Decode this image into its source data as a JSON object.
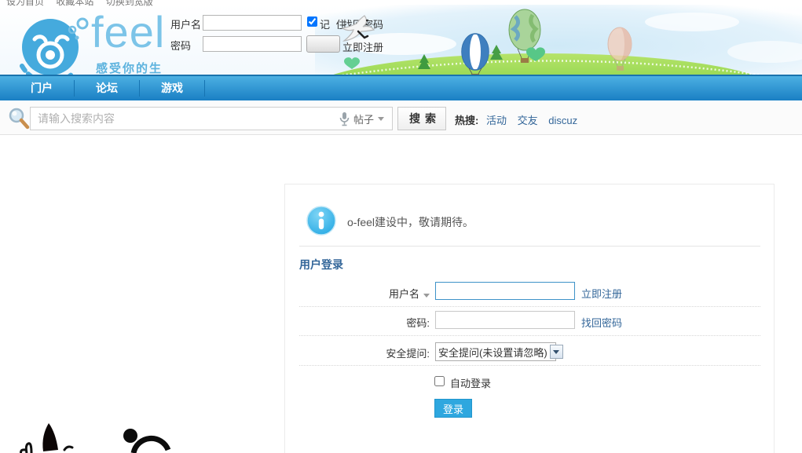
{
  "topbar": {
    "links": [
      {
        "label": "设为首页"
      },
      {
        "label": "收藏本站"
      },
      {
        "label": "切换到宽版"
      }
    ]
  },
  "logo": {
    "brand": "feel",
    "tagline": "感受你的生活"
  },
  "header_login": {
    "username_label": "用户名",
    "password_label": "密码",
    "remember_label": "记 住",
    "remember_checked": true,
    "find_password_link": "找回密码",
    "register_link": "立即注册"
  },
  "nav": {
    "items": [
      {
        "label": "门户"
      },
      {
        "label": "论坛"
      },
      {
        "label": "游戏"
      }
    ]
  },
  "search": {
    "placeholder": "请输入搜索内容",
    "scope": "帖子",
    "button_label": "搜索",
    "hot_label": "热搜:",
    "hot_links": [
      {
        "label": "活动"
      },
      {
        "label": "交友"
      },
      {
        "label": "discuz"
      }
    ]
  },
  "notice": {
    "text": "o-feel建设中，敬请期待。"
  },
  "login_panel": {
    "title": "用户登录",
    "username_label": "用户名",
    "register_link": "立即注册",
    "password_label": "密码:",
    "find_password_link": "找回密码",
    "security_label": "安全提问:",
    "security_selected": "安全提问(未设置请忽略)",
    "auto_login_label": "自动登录",
    "submit_label": "登录"
  },
  "colors": {
    "accent_blue": "#2ea7df",
    "link_blue": "#336699",
    "nav_gradient_top": "#4cb0e2",
    "nav_gradient_bottom": "#1a7fc4",
    "logo_blue": "#7cc4e8"
  }
}
